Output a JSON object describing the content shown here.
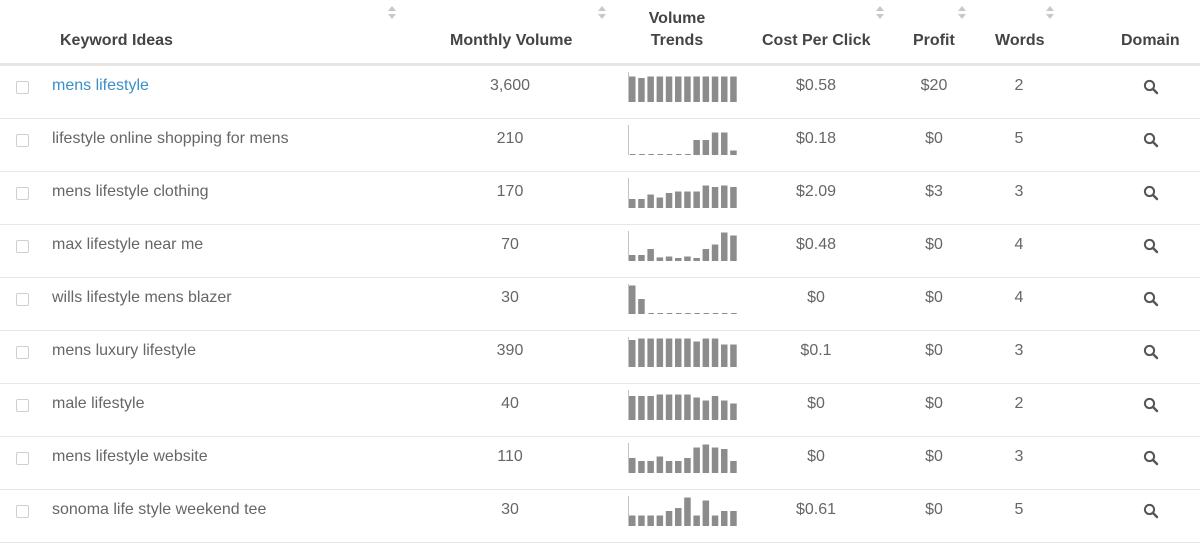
{
  "header": {
    "keyword": "Keyword Ideas",
    "volume": "Monthly Volume",
    "trends_line1": "Volume",
    "trends_line2": "Trends",
    "cpc": "Cost Per Click",
    "profit": "Profit",
    "words": "Words",
    "domain": "Domain"
  },
  "colors": {
    "link": "#3a8fc7",
    "bar": "#8c8c8c",
    "baseline": "#c4c4c4"
  },
  "icons": {
    "row_action": "search-icon",
    "sort": "sort-icon"
  },
  "rows": [
    {
      "keyword": "mens lifestyle",
      "volume": "3,600",
      "cpc": "$0.58",
      "profit": "$20",
      "words": "2",
      "trend": [
        0.85,
        0.8,
        0.85,
        0.85,
        0.85,
        0.85,
        0.85,
        0.85,
        0.85,
        0.85,
        0.85,
        0.85
      ]
    },
    {
      "keyword": "lifestyle online shopping for mens",
      "volume": "210",
      "cpc": "$0.18",
      "profit": "$0",
      "words": "5",
      "trend": [
        0,
        0,
        0,
        0,
        0,
        0,
        0,
        0.5,
        0.5,
        0.75,
        0.75,
        0.15
      ]
    },
    {
      "keyword": "mens lifestyle clothing",
      "volume": "170",
      "cpc": "$2.09",
      "profit": "$3",
      "words": "3",
      "trend": [
        0.3,
        0.3,
        0.45,
        0.35,
        0.5,
        0.55,
        0.55,
        0.55,
        0.75,
        0.7,
        0.75,
        0.7
      ]
    },
    {
      "keyword": "max lifestyle near me",
      "volume": "70",
      "cpc": "$0.48",
      "profit": "$0",
      "words": "4",
      "trend": [
        0.2,
        0.2,
        0.4,
        0.12,
        0.15,
        0.1,
        0.15,
        0.1,
        0.4,
        0.55,
        0.95,
        0.85
      ]
    },
    {
      "keyword": "wills lifestyle mens blazer",
      "volume": "30",
      "cpc": "$0",
      "profit": "$0",
      "words": "4",
      "trend": [
        0.95,
        0.5,
        0,
        0,
        0,
        0,
        0,
        0,
        0,
        0,
        0,
        0
      ]
    },
    {
      "keyword": "mens luxury lifestyle",
      "volume": "390",
      "cpc": "$0.1",
      "profit": "$0",
      "words": "3",
      "trend": [
        0.9,
        0.95,
        0.95,
        0.95,
        0.95,
        0.95,
        0.95,
        0.85,
        0.95,
        0.95,
        0.75,
        0.75
      ]
    },
    {
      "keyword": "male lifestyle",
      "volume": "40",
      "cpc": "$0",
      "profit": "$0",
      "words": "2",
      "trend": [
        0.8,
        0.8,
        0.8,
        0.85,
        0.85,
        0.85,
        0.85,
        0.75,
        0.65,
        0.8,
        0.65,
        0.55
      ]
    },
    {
      "keyword": "mens lifestyle website",
      "volume": "110",
      "cpc": "$0",
      "profit": "$0",
      "words": "3",
      "trend": [
        0.5,
        0.4,
        0.4,
        0.55,
        0.4,
        0.4,
        0.5,
        0.85,
        0.95,
        0.85,
        0.8,
        0.4
      ]
    },
    {
      "keyword": "sonoma life style weekend tee",
      "volume": "30",
      "cpc": "$0.61",
      "profit": "$0",
      "words": "5",
      "trend": [
        0.35,
        0.35,
        0.35,
        0.35,
        0.5,
        0.6,
        0.95,
        0.35,
        0.85,
        0.35,
        0.5,
        0.5
      ]
    }
  ]
}
